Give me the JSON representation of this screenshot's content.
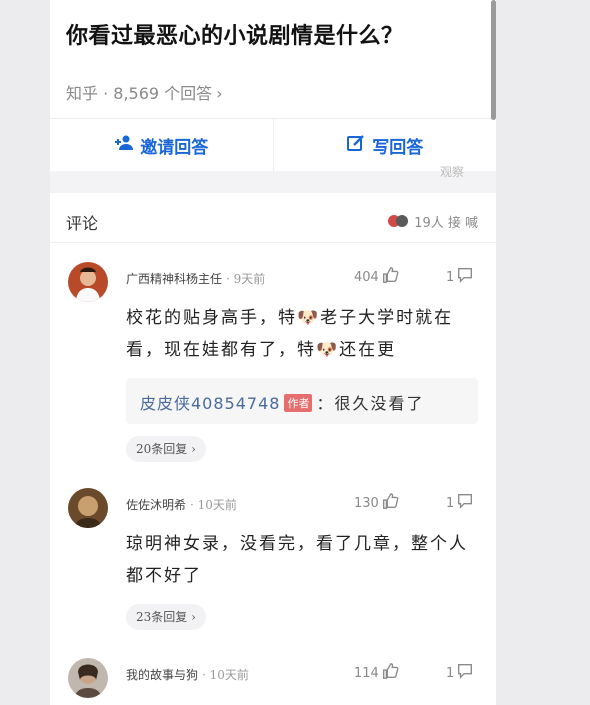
{
  "question": {
    "title": "你看过最恶心的小说剧情是什么？",
    "meta": "知乎 · 8,569 个回答",
    "chevron": "›"
  },
  "actions": {
    "invite_label": "邀请回答",
    "write_label": "写回答"
  },
  "watermark": "观察",
  "comments_header": {
    "title": "评论",
    "likes": "19人 接 喊"
  },
  "comments": [
    {
      "username": "广西精神科杨主任",
      "time": "· 9天前",
      "likes": "404",
      "replies": "1",
      "text": "校花的贴身高手，特🐶老子大学时就在看，现在娃都有了，特🐶还在更",
      "reply": {
        "user": "皮皮侠40854748",
        "badge": "作者",
        "text": "：很久没看了"
      },
      "more": "20条回复 ›"
    },
    {
      "username": "佐佐沐明希",
      "time": "· 10天前",
      "likes": "130",
      "replies": "1",
      "text": "琼明神女录，没看完，看了几章，整个人都不好了",
      "more": "23条回复 ›"
    },
    {
      "username": "我的故事与狗",
      "time": "· 10天前",
      "likes": "114",
      "replies": "1"
    }
  ],
  "colors": {
    "accent": "#1a66d8",
    "badge": "#e66e6e"
  }
}
